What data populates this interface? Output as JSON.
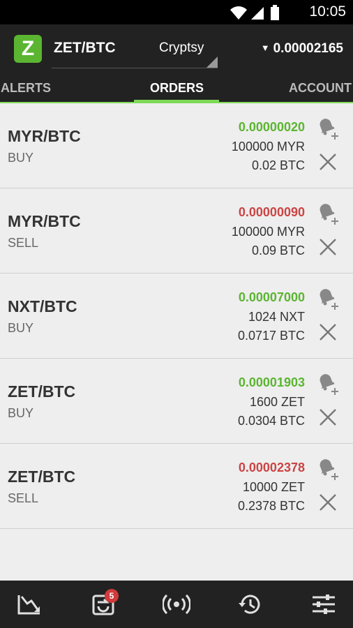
{
  "status_bar": {
    "time": "10:05"
  },
  "header": {
    "app_logo": "Z",
    "pair": "ZET/BTC",
    "exchange": "Cryptsy",
    "price": "0.00002165"
  },
  "tabs": [
    {
      "label": "ALERTS"
    },
    {
      "label": "ORDERS",
      "active": true
    },
    {
      "label": "ACCOUNT"
    }
  ],
  "orders": [
    {
      "pair": "MYR/BTC",
      "side": "BUY",
      "price": "0.00000020",
      "price_color": "green",
      "amount": "100000 MYR",
      "total": "0.02 BTC"
    },
    {
      "pair": "MYR/BTC",
      "side": "SELL",
      "price": "0.00000090",
      "price_color": "red",
      "amount": "100000 MYR",
      "total": "0.09 BTC"
    },
    {
      "pair": "NXT/BTC",
      "side": "BUY",
      "price": "0.00007000",
      "price_color": "green",
      "amount": "1024 NXT",
      "total": "0.0717 BTC"
    },
    {
      "pair": "ZET/BTC",
      "side": "BUY",
      "price": "0.00001903",
      "price_color": "green",
      "amount": "1600 ZET",
      "total": "0.0304 BTC"
    },
    {
      "pair": "ZET/BTC",
      "side": "SELL",
      "price": "0.00002378",
      "price_color": "red",
      "amount": "10000 ZET",
      "total": "0.2378 BTC"
    }
  ],
  "bottom_nav": {
    "items": [
      "chart-down-icon",
      "refresh-orders-icon",
      "broadcast-icon",
      "history-icon",
      "settings-sliders-icon"
    ],
    "badge": "5"
  },
  "colors": {
    "accent": "#7ed957",
    "buy": "#5bb531",
    "sell": "#cc4444",
    "bar": "#222222"
  }
}
